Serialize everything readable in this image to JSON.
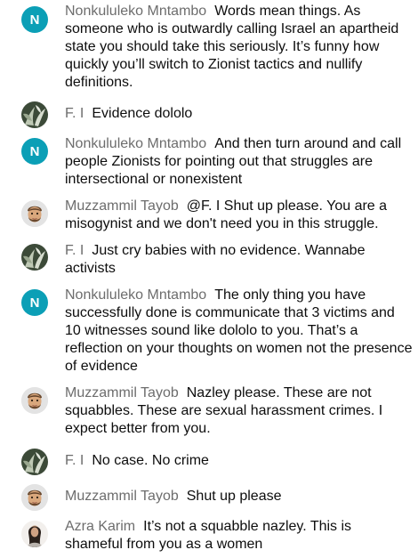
{
  "colors": {
    "author": "#6d6d6d",
    "text": "#0d0d0d",
    "avatar_n": "#0b9fb6"
  },
  "messages": [
    {
      "author": "Nonkululeko Mntambo",
      "avatar": {
        "type": "letter",
        "letter": "N"
      },
      "text": "Words mean things. As someone who is outwardly calling Israel an apartheid state you should take this seriously. It’s funny how quickly you’ll switch to Zionist tactics and nullify definitions."
    },
    {
      "author": "F. I",
      "avatar": {
        "type": "photo-plant"
      },
      "text": "Evidence dololo"
    },
    {
      "author": "Nonkululeko Mntambo",
      "avatar": {
        "type": "letter",
        "letter": "N"
      },
      "text": "And then turn around and call people Zionists for pointing out that struggles are intersectional or nonexistent"
    },
    {
      "author": "Muzzammil Tayob",
      "avatar": {
        "type": "memoji"
      },
      "text": "@F. I Shut up please. You are a misogynist and we don't need you in this struggle."
    },
    {
      "author": "F. I",
      "avatar": {
        "type": "photo-plant"
      },
      "text": "Just cry babies with no evidence. Wannabe activists"
    },
    {
      "author": "Nonkululeko Mntambo",
      "avatar": {
        "type": "letter",
        "letter": "N"
      },
      "text": "The only thing you have successfully done is communicate that 3 victims and 10 witnesses sound like dololo to you. That’s a reflection on your thoughts on women not the presence of evidence"
    },
    {
      "author": "Muzzammil Tayob",
      "avatar": {
        "type": "memoji"
      },
      "text": "Nazley please. These are not squabbles. These are sexual harassment crimes. I expect better from you."
    },
    {
      "author": "F. I",
      "avatar": {
        "type": "photo-plant"
      },
      "text": "No case. No crime"
    },
    {
      "author": "Muzzammil Tayob",
      "avatar": {
        "type": "memoji"
      },
      "text": "Shut up please"
    },
    {
      "author": "Azra Karim",
      "avatar": {
        "type": "photo-person"
      },
      "text": "It’s not a squabble nazley. This is shameful from you as a women"
    }
  ]
}
